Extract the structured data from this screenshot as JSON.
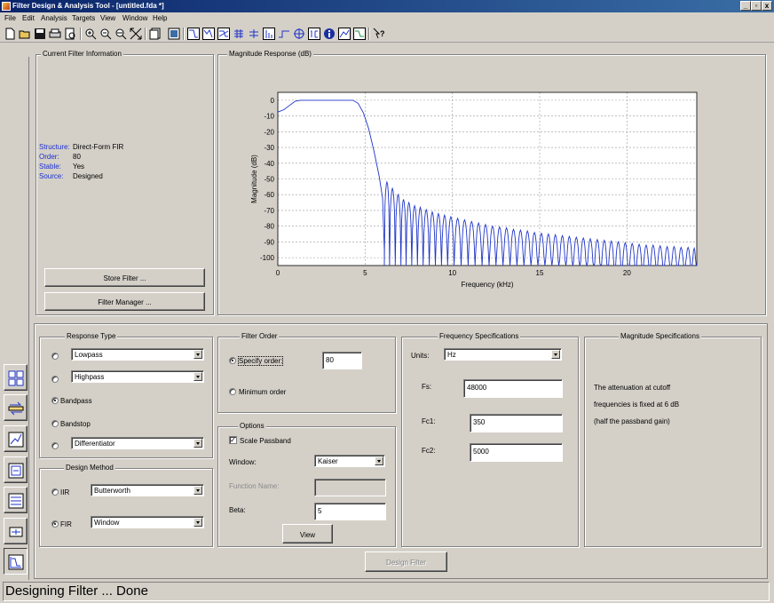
{
  "window": {
    "title": "Filter Design & Analysis Tool - [untitled.fda *]",
    "buttons": {
      "minimize": "_",
      "restore": "▫",
      "close": "x"
    }
  },
  "menu": [
    "File",
    "Edit",
    "Analysis",
    "Targets",
    "View",
    "Window",
    "Help"
  ],
  "filter_info": {
    "title": "Current Filter Information",
    "rows": [
      {
        "label": "Structure:",
        "value": "Direct-Form FIR"
      },
      {
        "label": "Order:",
        "value": "80"
      },
      {
        "label": "Stable:",
        "value": "Yes"
      },
      {
        "label": "Source:",
        "value": "Designed"
      }
    ],
    "store_button": "Store Filter ...",
    "manager_button": "Filter Manager ..."
  },
  "plot": {
    "panel_title": "Magnitude Response (dB)"
  },
  "chart_data": {
    "type": "line",
    "title": "",
    "xlabel": "Frequency (kHz)",
    "ylabel": "Magnitude (dB)",
    "xlim": [
      0,
      24
    ],
    "ylim": [
      -105,
      5
    ],
    "x_ticks": [
      0,
      5,
      10,
      15,
      20
    ],
    "y_ticks": [
      0,
      -10,
      -20,
      -30,
      -40,
      -50,
      -60,
      -70,
      -80,
      -90,
      -100
    ],
    "grid": true,
    "series": [
      {
        "color": "#1f35c8",
        "description_points": [
          [
            0,
            -7.5
          ],
          [
            0.35,
            -6
          ],
          [
            0.7,
            -3
          ],
          [
            1.0,
            -0.6
          ],
          [
            1.3,
            0
          ],
          [
            4.3,
            0
          ],
          [
            4.6,
            -2
          ],
          [
            4.9,
            -8
          ],
          [
            5.2,
            -18
          ],
          [
            5.5,
            -32
          ],
          [
            5.8,
            -48
          ],
          [
            6.0,
            -62
          ],
          [
            6.1,
            -95
          ]
        ],
        "sidelobe_peaks": [
          [
            6.25,
            -52
          ],
          [
            6.55,
            -56
          ],
          [
            6.9,
            -60
          ],
          [
            7.2,
            -63
          ],
          [
            7.5,
            -65
          ],
          [
            7.85,
            -67
          ],
          [
            8.15,
            -68
          ],
          [
            8.5,
            -69.5
          ],
          [
            8.85,
            -71
          ],
          [
            9.2,
            -72
          ],
          [
            9.55,
            -73
          ],
          [
            9.9,
            -74
          ],
          [
            10.3,
            -75
          ],
          [
            10.7,
            -76
          ],
          [
            11.1,
            -77
          ],
          [
            11.5,
            -78
          ],
          [
            11.9,
            -79
          ],
          [
            12.3,
            -80
          ],
          [
            12.7,
            -80.5
          ],
          [
            13.1,
            -81
          ],
          [
            13.5,
            -82
          ],
          [
            13.9,
            -82.5
          ],
          [
            14.3,
            -83
          ],
          [
            14.7,
            -84
          ],
          [
            15.1,
            -84.5
          ],
          [
            15.5,
            -85
          ],
          [
            15.9,
            -85.5
          ],
          [
            16.3,
            -86
          ],
          [
            16.7,
            -86.5
          ],
          [
            17.1,
            -87
          ],
          [
            17.5,
            -87.5
          ],
          [
            17.9,
            -88
          ],
          [
            18.3,
            -88.5
          ],
          [
            18.7,
            -89
          ],
          [
            19.1,
            -89.5
          ],
          [
            19.5,
            -90
          ],
          [
            19.9,
            -90.5
          ],
          [
            20.3,
            -91
          ],
          [
            20.7,
            -91.5
          ],
          [
            21.1,
            -92
          ],
          [
            21.5,
            -92
          ],
          [
            21.9,
            -92.5
          ],
          [
            22.3,
            -93
          ],
          [
            22.7,
            -93
          ],
          [
            23.1,
            -93.5
          ],
          [
            23.5,
            -93.5
          ],
          [
            23.9,
            -94
          ]
        ]
      }
    ]
  },
  "response_type": {
    "title": "Response Type",
    "options": [
      {
        "label": "",
        "combo": "Lowpass",
        "selected": false
      },
      {
        "label": "",
        "combo": "Highpass",
        "selected": false
      },
      {
        "label": "Bandpass",
        "combo": "",
        "selected": true
      },
      {
        "label": "Bandstop",
        "combo": "",
        "selected": false
      },
      {
        "label": "",
        "combo": "Differentiator",
        "selected": false
      }
    ]
  },
  "design_method": {
    "title": "Design Method",
    "iir_label": "IIR",
    "iir_value": "Butterworth",
    "fir_label": "FIR",
    "fir_value": "Window",
    "selected": "FIR"
  },
  "filter_order": {
    "title": "Filter Order",
    "specify_label": "Specify order:",
    "specify_value": "80",
    "minimum_label": "Minimum order",
    "selected": "specify"
  },
  "options": {
    "title": "Options",
    "scale_passband_label": "Scale Passband",
    "scale_passband_checked": true,
    "check_mark": "✓",
    "window_label": "Window:",
    "window_value": "Kaiser",
    "function_name_label": "Function Name:",
    "function_name_value": "",
    "beta_label": "Beta:",
    "beta_value": "5",
    "view_button": "View"
  },
  "frequency_specs": {
    "title": "Frequency Specifications",
    "units_label": "Units:",
    "units_value": "Hz",
    "fs_label": "Fs:",
    "fs_value": "48000",
    "fc1_label": "Fc1:",
    "fc1_value": "350",
    "fc2_label": "Fc2:",
    "fc2_value": "5000"
  },
  "magnitude_specs": {
    "title": "Magnitude Specifications",
    "lines": [
      "The attenuation at cutoff",
      "frequencies is fixed at 6 dB",
      "(half the passband gain)"
    ]
  },
  "design_button": "Design Filter",
  "status": "Designing Filter ... Done",
  "sidebar_icons": [
    "transform-filter-icon",
    "convert-structure-icon",
    "pole-zero-editor-icon",
    "import-filter-icon",
    "multirate-icon",
    "realize-model-icon",
    "design-filter-icon"
  ]
}
